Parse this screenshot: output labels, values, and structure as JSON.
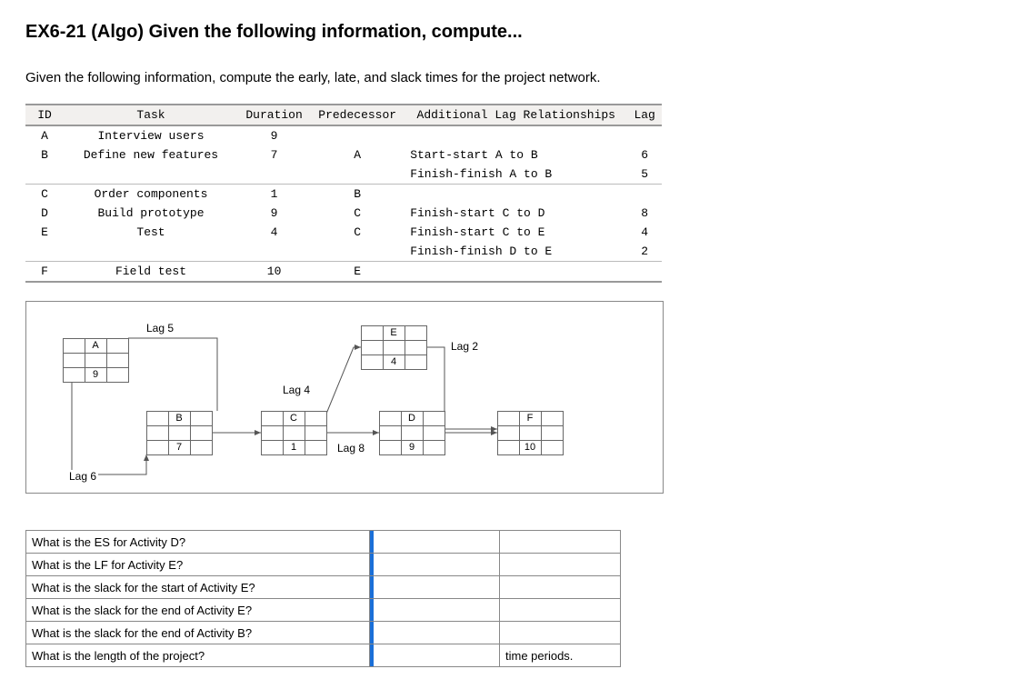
{
  "title": "EX6-21 (Algo) Given the following information, compute...",
  "prompt": "Given the following information, compute the early, late, and slack times for the project network.",
  "table": {
    "headers": [
      "ID",
      "Task",
      "Duration",
      "Predecessor",
      "Additional Lag Relationships",
      "Lag"
    ],
    "rows": [
      {
        "id": "A",
        "task": "Interview users",
        "dur": "9",
        "pred": "",
        "rel": "",
        "lag": ""
      },
      {
        "id": "B",
        "task": "Define new features",
        "dur": "7",
        "pred": "A",
        "rel": "Start-start A to B",
        "lag": "6"
      },
      {
        "id": "",
        "task": "",
        "dur": "",
        "pred": "",
        "rel": "Finish-finish A to B",
        "lag": "5"
      },
      {
        "id": "C",
        "task": "Order components",
        "dur": "1",
        "pred": "B",
        "rel": "",
        "lag": ""
      },
      {
        "id": "D",
        "task": "Build prototype",
        "dur": "9",
        "pred": "C",
        "rel": "Finish-start C to D",
        "lag": "8"
      },
      {
        "id": "E",
        "task": "Test",
        "dur": "4",
        "pred": "C",
        "rel": "Finish-start C to E",
        "lag": "4"
      },
      {
        "id": "",
        "task": "",
        "dur": "",
        "pred": "",
        "rel": "Finish-finish D to E",
        "lag": "2"
      },
      {
        "id": "F",
        "task": "Field test",
        "dur": "10",
        "pred": "E",
        "rel": "",
        "lag": ""
      }
    ]
  },
  "diagram": {
    "nodes": {
      "A": {
        "label": "A",
        "dur": "9"
      },
      "B": {
        "label": "B",
        "dur": "7"
      },
      "C": {
        "label": "C",
        "dur": "1"
      },
      "D": {
        "label": "D",
        "dur": "9"
      },
      "E": {
        "label": "E",
        "dur": "4"
      },
      "F": {
        "label": "F",
        "dur": "10"
      }
    },
    "lags": {
      "l5": "Lag 5",
      "l6": "Lag 6",
      "l4": "Lag 4",
      "l8": "Lag 8",
      "l2": "Lag 2"
    }
  },
  "questions": [
    {
      "q": "What is the ES for Activity D?",
      "unit": ""
    },
    {
      "q": "What is the LF for Activity E?",
      "unit": ""
    },
    {
      "q": "What is the slack for the start of Activity E?",
      "unit": ""
    },
    {
      "q": "What is the slack for the end of Activity E?",
      "unit": ""
    },
    {
      "q": "What is the slack for the end of Activity B?",
      "unit": ""
    },
    {
      "q": "What is the length of the project?",
      "unit": "time periods."
    }
  ]
}
